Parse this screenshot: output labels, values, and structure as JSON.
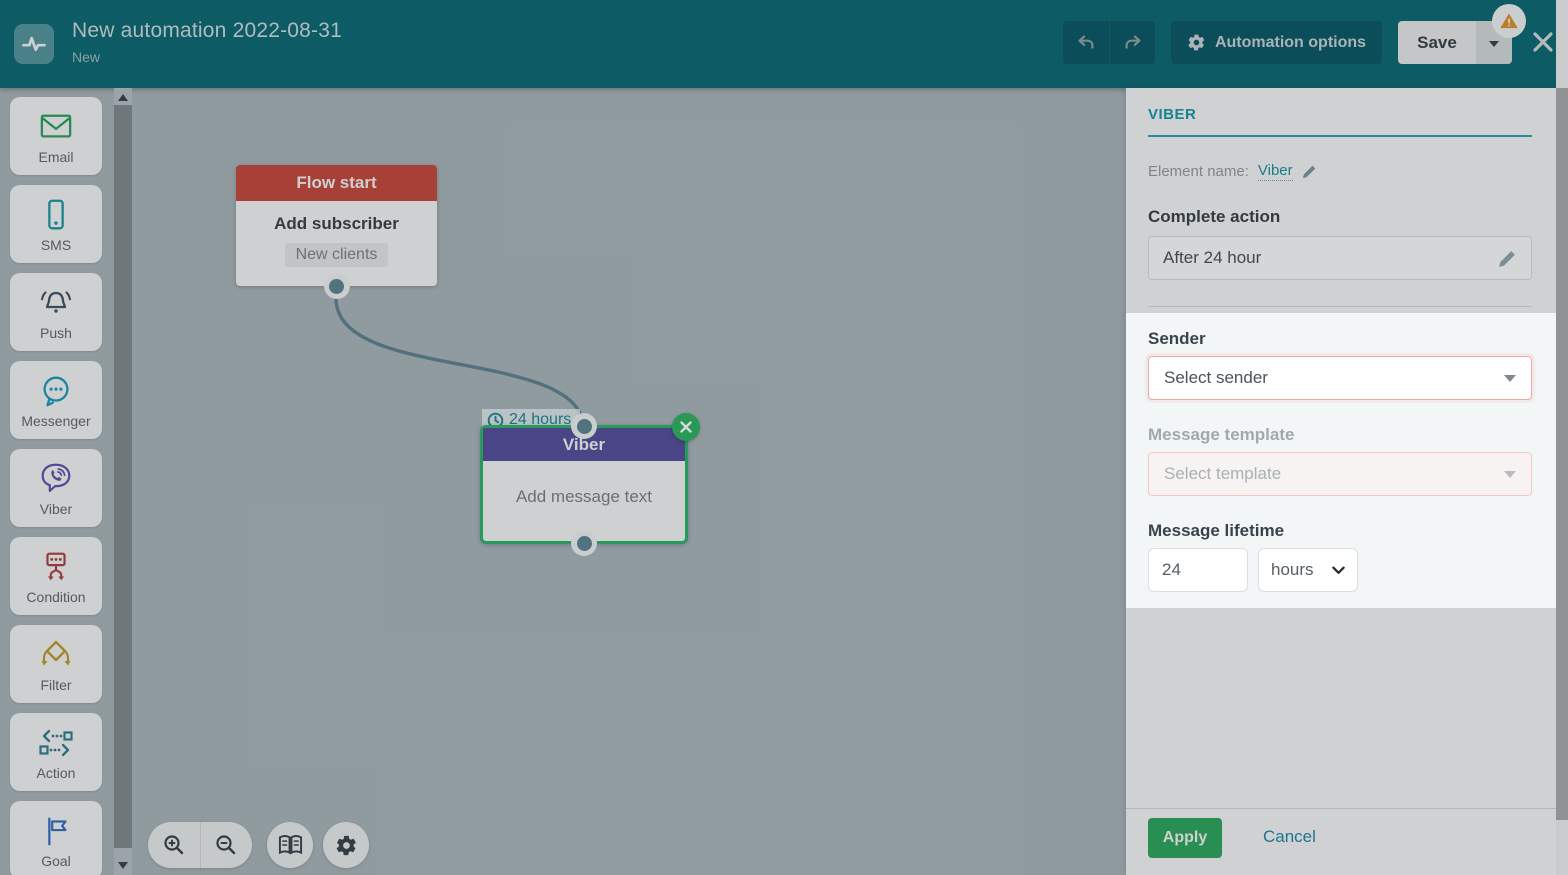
{
  "header": {
    "title": "New automation 2022-08-31",
    "subtitle": "New",
    "automation_options": "Automation options",
    "save": "Save"
  },
  "sidebar": {
    "items": [
      {
        "label": "Email",
        "icon": "email-icon",
        "color": "#2FA05C"
      },
      {
        "label": "SMS",
        "icon": "sms-icon",
        "color": "#1B97A3"
      },
      {
        "label": "Push",
        "icon": "push-bell-icon",
        "color": "#435663"
      },
      {
        "label": "Messenger",
        "icon": "messenger-icon",
        "color": "#1C9DBE"
      },
      {
        "label": "Viber",
        "icon": "viber-icon",
        "color": "#5F53AE"
      },
      {
        "label": "Condition",
        "icon": "condition-icon",
        "color": "#AC4440"
      },
      {
        "label": "Filter",
        "icon": "filter-icon",
        "color": "#C09A33"
      },
      {
        "label": "Action",
        "icon": "action-icon",
        "color": "#35808E"
      },
      {
        "label": "Goal",
        "icon": "goal-flag-icon",
        "color": "#3A6FC0"
      }
    ]
  },
  "canvas": {
    "flow_start": {
      "title": "Flow start",
      "subtitle": "Add subscriber",
      "badge": "New clients"
    },
    "delay_label": "24 hours",
    "viber_node": {
      "title": "Viber",
      "placeholder": "Add message text"
    }
  },
  "panel": {
    "heading": "VIBER",
    "element_name_label": "Element name:",
    "element_name_value": "Viber",
    "complete_action_label": "Complete action",
    "complete_action_value": "After 24 hour",
    "sender_label": "Sender",
    "sender_placeholder": "Select sender",
    "template_label": "Message template",
    "template_placeholder": "Select template",
    "lifetime_label": "Message lifetime",
    "lifetime_value": "24",
    "lifetime_unit": "hours",
    "apply": "Apply",
    "cancel": "Cancel"
  },
  "colors": {
    "header_teal": "#0E6A75",
    "accent_teal": "#1A9AA9",
    "selected_green": "#2EB566",
    "apply_green": "#2FA65D",
    "flow_start_red": "#C44A3E",
    "viber_purple": "#55509C",
    "warning_orange": "#DD9A31",
    "error_border": "#F0A8A0"
  }
}
